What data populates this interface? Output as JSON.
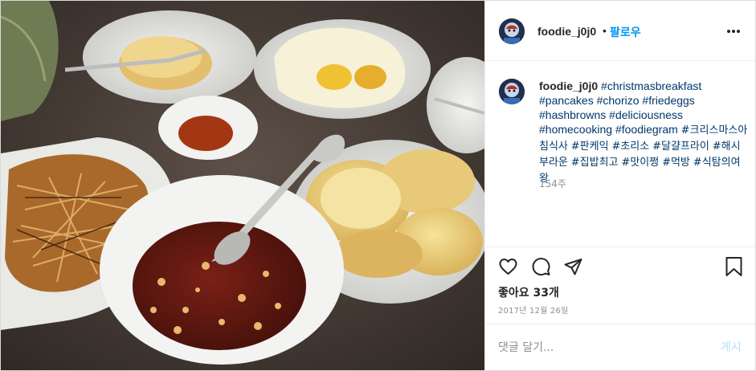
{
  "post": {
    "username": "foodie_j0j0",
    "follow_label": "팔로우",
    "dot": "•"
  },
  "caption": {
    "username": "foodie_j0j0",
    "hashtags": [
      "#christmasbreakfast",
      "#pancakes",
      "#chorizo",
      "#friedeggs",
      "#hashbrowns",
      "#deliciousness",
      "#homecooking",
      "#foodiegram",
      "#크리스마스아침식사",
      "#판케익",
      "#초리소",
      "#달걀프라이",
      "#해시부라운",
      "#집밥최고",
      "#맛이쩡",
      "#먹방",
      "#식탐의여왕"
    ],
    "time": "154주"
  },
  "actions": {
    "likes": "좋아요 33개",
    "date": "2017년 12월 26일",
    "icons": [
      "heart-icon",
      "comment-icon",
      "share-icon",
      "bookmark-icon"
    ]
  },
  "comment": {
    "placeholder": "댓글 달기...",
    "post_label": "게시"
  },
  "colors": {
    "link": "#00376b",
    "follow": "#0095f6",
    "post_disabled": "#b2dffc",
    "muted": "#8e8e8e"
  }
}
